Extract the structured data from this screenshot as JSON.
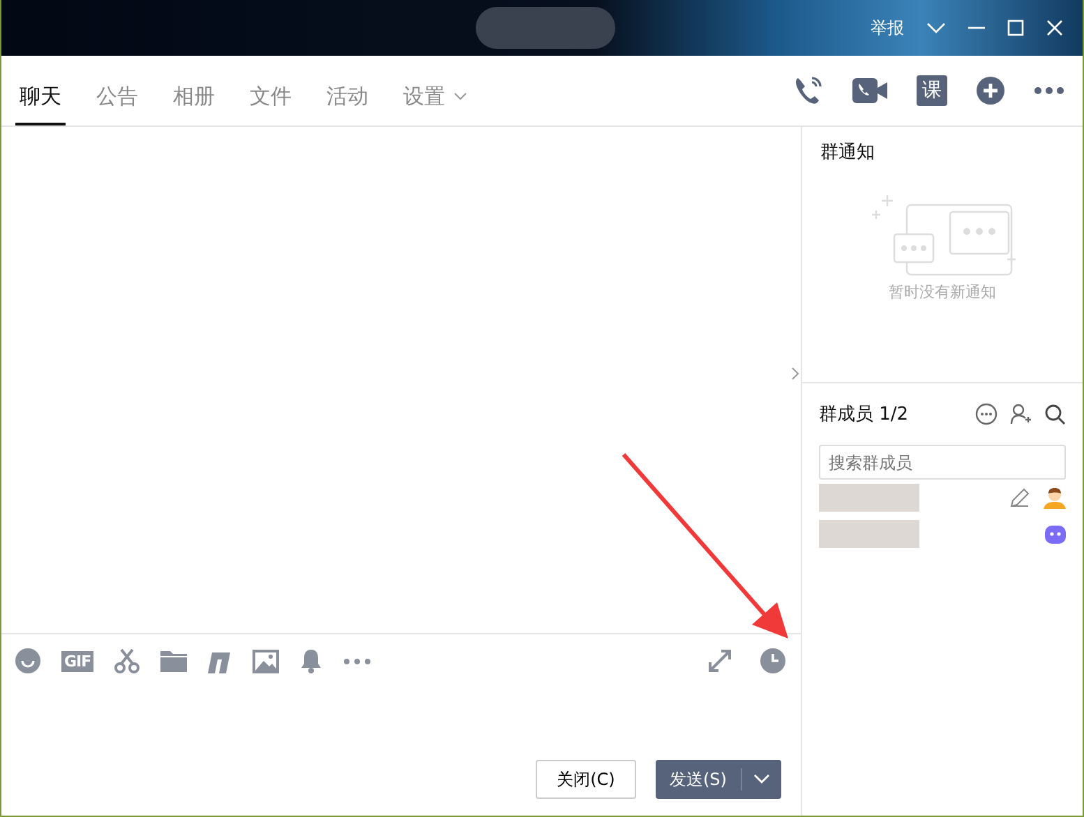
{
  "title_bar": {
    "report": "举报"
  },
  "tabs": [
    {
      "label": "聊天",
      "selected": true,
      "dropdown": false
    },
    {
      "label": "公告",
      "selected": false,
      "dropdown": false
    },
    {
      "label": "相册",
      "selected": false,
      "dropdown": false
    },
    {
      "label": "文件",
      "selected": false,
      "dropdown": false
    },
    {
      "label": "活动",
      "selected": false,
      "dropdown": false
    },
    {
      "label": "设置",
      "selected": false,
      "dropdown": true
    }
  ],
  "header_actions": [
    {
      "kind": "phone"
    },
    {
      "kind": "video"
    },
    {
      "kind": "lesson",
      "label": "课"
    },
    {
      "kind": "plus"
    },
    {
      "kind": "more"
    }
  ],
  "toolbar": [
    {
      "kind": "emoji"
    },
    {
      "kind": "gif",
      "label": "GIF"
    },
    {
      "kind": "scissors"
    },
    {
      "kind": "folder"
    },
    {
      "kind": "music"
    },
    {
      "kind": "image"
    },
    {
      "kind": "bell"
    },
    {
      "kind": "more"
    }
  ],
  "buttons": {
    "close": "关闭(C)",
    "send": "发送(S)"
  },
  "notice": {
    "title": "群通知",
    "empty_text": "暂时没有新通知"
  },
  "members": {
    "title": "群成员 1/2",
    "search": {
      "placeholder": "搜索群成员"
    },
    "rows": [
      {
        "kind": "person"
      },
      {
        "kind": "bot"
      }
    ]
  }
}
